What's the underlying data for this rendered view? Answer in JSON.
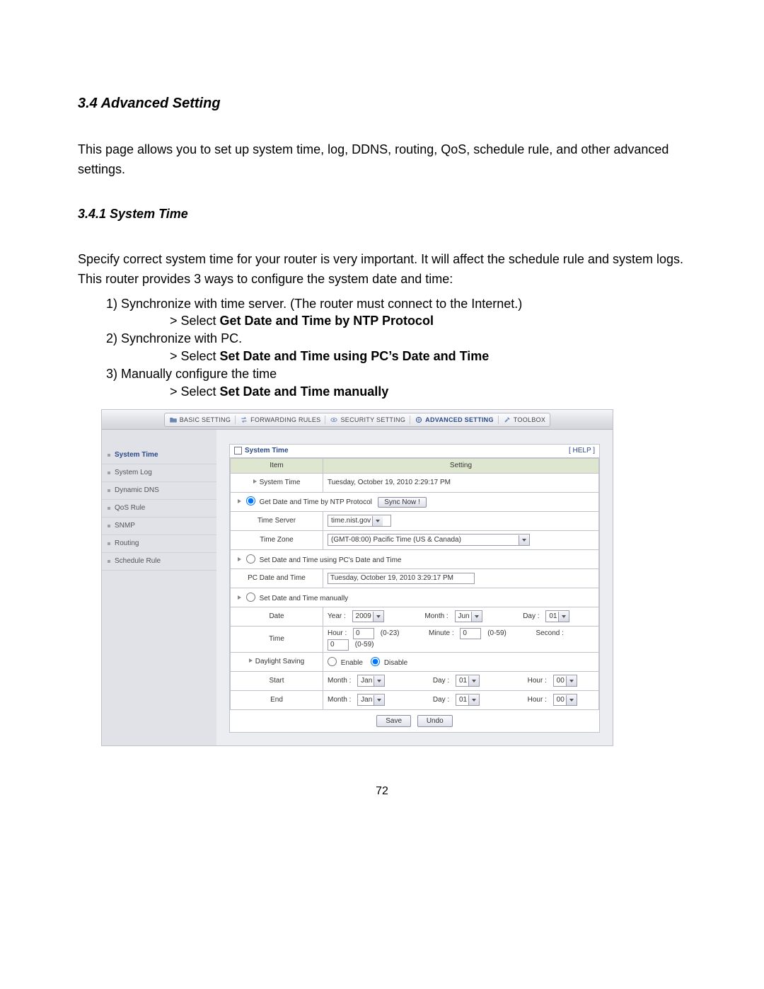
{
  "doc": {
    "h1": "3.4 Advanced Setting",
    "p1": "This page allows you to set up system time, log, DDNS, routing, QoS, schedule rule, and other advanced settings.",
    "h2": "3.4.1 System Time",
    "p2": "Specify correct system time for your router is very important. It will affect the schedule rule and system logs. This router provides 3 ways to configure the system date and time:",
    "li1": "1)  Synchronize with time server. (The router must connect to the Internet.)",
    "s1p": "> Select ",
    "s1b": "Get Date and Time by NTP Protocol",
    "li2": "2)  Synchronize with PC.",
    "s2p": "> Select ",
    "s2b": "Set Date and Time using PC’s Date and Time",
    "li3": "3)  Manually configure the time",
    "s3p": "> Select ",
    "s3b": "Set Date and Time manually",
    "pageno": "72"
  },
  "tabs": {
    "basic": "BASIC SETTING",
    "fwd": "FORWARDING RULES",
    "sec": "SECURITY SETTING",
    "adv": "ADVANCED SETTING",
    "tool": "TOOLBOX"
  },
  "sidebar": {
    "items": [
      "System Time",
      "System Log",
      "Dynamic DNS",
      "QoS Rule",
      "SNMP",
      "Routing",
      "Schedule Rule"
    ]
  },
  "panel": {
    "title": "System Time",
    "help": "[ HELP ]",
    "cols": {
      "item": "Item",
      "setting": "Setting"
    },
    "systime_label": "System Time",
    "systime_value": "Tuesday, October 19, 2010 2:29:17 PM",
    "opt_ntp": "Get Date and Time by NTP Protocol",
    "sync_btn": "Sync Now !",
    "timeserver_label": "Time Server",
    "timeserver_value": "time.nist.gov",
    "timezone_label": "Time Zone",
    "timezone_value": "(GMT-08:00) Pacific Time (US & Canada)",
    "opt_pc": "Set Date and Time using PC's Date and Time",
    "pc_label": "PC Date and Time",
    "pc_value": "Tuesday, October 19, 2010 3:29:17 PM",
    "opt_manual": "Set Date and Time manually",
    "date_label": "Date",
    "date_year_l": "Year :",
    "date_year_v": "2009",
    "date_month_l": "Month :",
    "date_month_v": "Jun",
    "date_day_l": "Day :",
    "date_day_v": "01",
    "time_label": "Time",
    "time_hour_l": "Hour :",
    "time_hour_v": "0",
    "time_hour_r": "(0-23)",
    "time_min_l": "Minute :",
    "time_min_v": "0",
    "time_min_r": "(0-59)",
    "time_sec_l": "Second :",
    "time_sec_v": "0",
    "time_sec_r": "(0-59)",
    "dls_label": "Daylight Saving",
    "dls_enable": "Enable",
    "dls_disable": "Disable",
    "start_label": "Start",
    "end_label": "End",
    "mon_l": "Month :",
    "mon_v": "Jan",
    "day_l": "Day :",
    "day_v": "01",
    "hour_l": "Hour :",
    "hour_v": "00",
    "save_btn": "Save",
    "undo_btn": "Undo"
  }
}
